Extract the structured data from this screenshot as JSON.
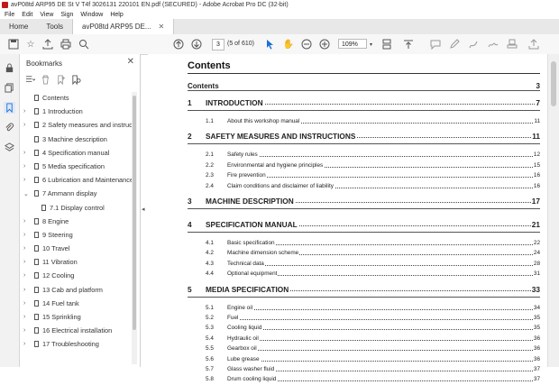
{
  "window": {
    "title": "avP08td ARP95 DE St V T4f 3026131 220101 EN.pdf (SECURED) - Adobe Acrobat Pro DC (32-bit)"
  },
  "menu": [
    "File",
    "Edit",
    "View",
    "Sign",
    "Window",
    "Help"
  ],
  "tabs": {
    "home": "Home",
    "tools": "Tools",
    "document": "avP08td ARP95 DE..."
  },
  "toolbar": {
    "page_number": "3",
    "page_of": "(5 of 610)",
    "zoom": "109%"
  },
  "bookmarks": {
    "title": "Bookmarks",
    "items": [
      {
        "label": "Contents",
        "level": 0,
        "chevron": ""
      },
      {
        "label": "1 Introduction",
        "level": 0,
        "chevron": ">"
      },
      {
        "label": "2 Safety measures and instructi",
        "level": 0,
        "chevron": ">"
      },
      {
        "label": "3 Machine description",
        "level": 0,
        "chevron": ""
      },
      {
        "label": "4 Specification manual",
        "level": 0,
        "chevron": ">"
      },
      {
        "label": "5 Media specification",
        "level": 0,
        "chevron": ">"
      },
      {
        "label": "6 Lubrication and Maintenance",
        "level": 0,
        "chevron": ">"
      },
      {
        "label": "7 Ammann display",
        "level": 0,
        "chevron": "v"
      },
      {
        "label": "7.1 Display control",
        "level": 1,
        "chevron": ""
      },
      {
        "label": "8 Engine",
        "level": 0,
        "chevron": ">"
      },
      {
        "label": "9 Steering",
        "level": 0,
        "chevron": ">"
      },
      {
        "label": "10 Travel",
        "level": 0,
        "chevron": ">"
      },
      {
        "label": "11 Vibration",
        "level": 0,
        "chevron": ">"
      },
      {
        "label": "12 Cooling",
        "level": 0,
        "chevron": ">"
      },
      {
        "label": "13 Cab and platform",
        "level": 0,
        "chevron": ">"
      },
      {
        "label": "14 Fuel tank",
        "level": 0,
        "chevron": ">"
      },
      {
        "label": "15 Sprinkling",
        "level": 0,
        "chevron": ">"
      },
      {
        "label": "16 Electrical installation",
        "level": 0,
        "chevron": ">"
      },
      {
        "label": "17 Troubleshooting",
        "level": 0,
        "chevron": ">"
      }
    ]
  },
  "document": {
    "heading": "Contents",
    "contents_label": "Contents",
    "contents_page": "3",
    "toc": [
      {
        "num": "1",
        "title": "INTRODUCTION",
        "page": "7",
        "kind": "chapter"
      },
      {
        "num": "1.1",
        "title": "About this workshop manual",
        "page": "11",
        "kind": "section"
      },
      {
        "num": "2",
        "title": "SAFETY MEASURES AND INSTRUCTIONS",
        "page": "11",
        "kind": "chapter"
      },
      {
        "num": "2.1",
        "title": "Safety rules",
        "page": "12",
        "kind": "section"
      },
      {
        "num": "2.2",
        "title": "Environmental and hygiene principles",
        "page": "15",
        "kind": "section"
      },
      {
        "num": "2.3",
        "title": "Fire prevention",
        "page": "16",
        "kind": "section"
      },
      {
        "num": "2.4",
        "title": "Claim conditions and disclaimer of liability",
        "page": "16",
        "kind": "section"
      },
      {
        "num": "3",
        "title": "MACHINE DESCRIPTION",
        "page": "17",
        "kind": "chapter"
      },
      {
        "num": "4",
        "title": "SPECIFICATION MANUAL",
        "page": "21",
        "kind": "chapter"
      },
      {
        "num": "4.1",
        "title": "Basic specification",
        "page": "22",
        "kind": "section"
      },
      {
        "num": "4.2",
        "title": "Machine dimension scheme",
        "page": "24",
        "kind": "section"
      },
      {
        "num": "4.3",
        "title": "Technical data",
        "page": "28",
        "kind": "section"
      },
      {
        "num": "4.4",
        "title": "Optional equipment",
        "page": "31",
        "kind": "section"
      },
      {
        "num": "5",
        "title": "MEDIA SPECIFICATION",
        "page": "33",
        "kind": "chapter"
      },
      {
        "num": "5.1",
        "title": "Engine oil",
        "page": "34",
        "kind": "section"
      },
      {
        "num": "5.2",
        "title": "Fuel",
        "page": "35",
        "kind": "section"
      },
      {
        "num": "5.3",
        "title": "Cooling liquid",
        "page": "35",
        "kind": "section"
      },
      {
        "num": "5.4",
        "title": "Hydraulic oil",
        "page": "36",
        "kind": "section"
      },
      {
        "num": "5.5",
        "title": "Gearbox oil",
        "page": "36",
        "kind": "section"
      },
      {
        "num": "5.6",
        "title": "Lube grease",
        "page": "36",
        "kind": "section"
      },
      {
        "num": "5.7",
        "title": "Glass washer fluid",
        "page": "37",
        "kind": "section"
      },
      {
        "num": "5.8",
        "title": "Drum cooling liquid",
        "page": "37",
        "kind": "section"
      }
    ]
  }
}
